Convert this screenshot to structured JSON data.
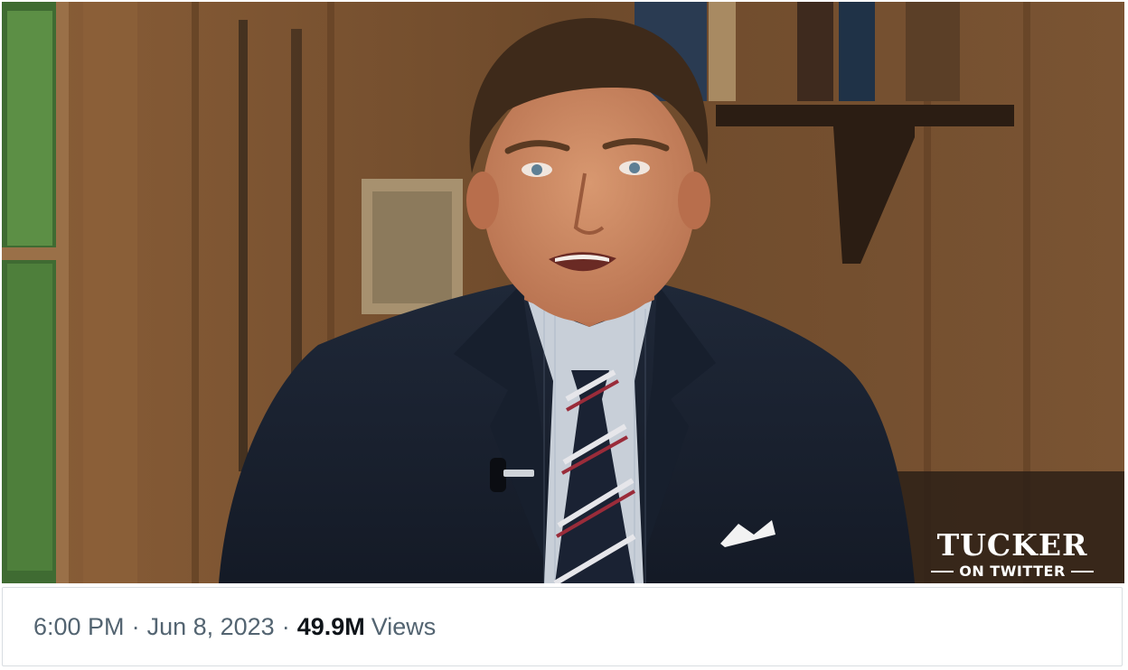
{
  "video": {
    "watermark_title": "TUCKER",
    "watermark_subtitle": "ON TWITTER"
  },
  "meta": {
    "time": "6:00 PM",
    "separator": "·",
    "date": "Jun 8, 2023",
    "views_count": "49.9M",
    "views_label": "Views"
  },
  "colors": {
    "meta_text": "#536471",
    "meta_strong": "#0f1419",
    "border": "#d8dde1"
  }
}
